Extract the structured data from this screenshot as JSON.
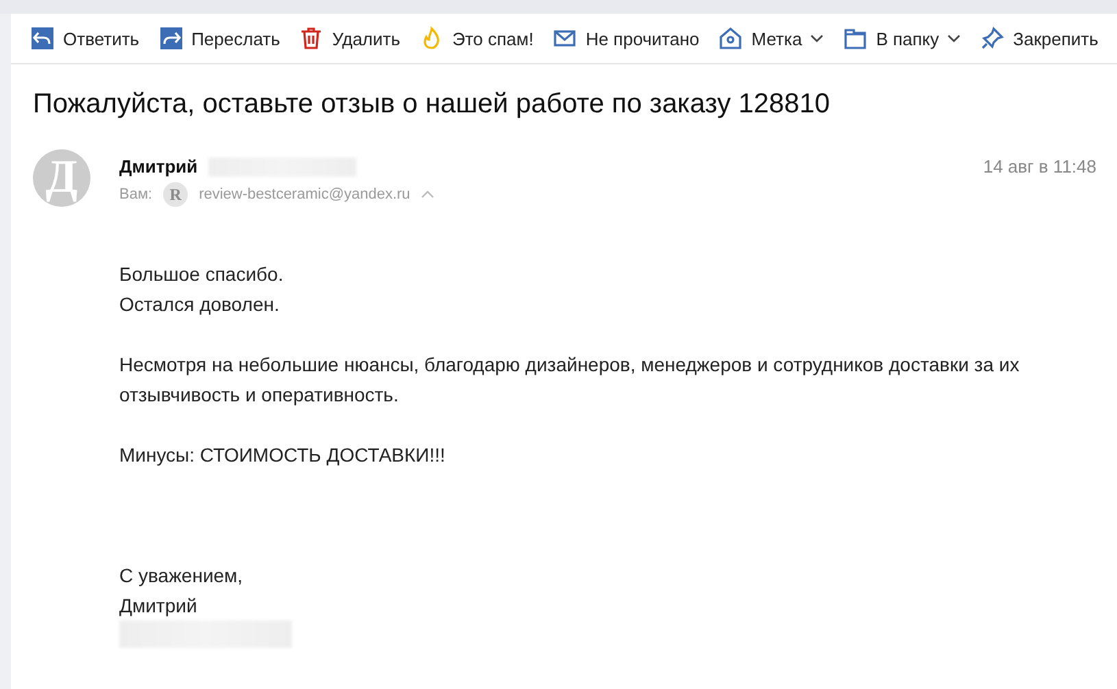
{
  "toolbar": [
    {
      "kind": "reply",
      "label": "Ответить",
      "has_menu": false
    },
    {
      "kind": "forward",
      "label": "Переслать",
      "has_menu": false
    },
    {
      "kind": "delete",
      "label": "Удалить",
      "has_menu": false
    },
    {
      "kind": "spam",
      "label": "Это спам!",
      "has_menu": false
    },
    {
      "kind": "unread",
      "label": "Не прочитано",
      "has_menu": false
    },
    {
      "kind": "label",
      "label": "Метка",
      "has_menu": true
    },
    {
      "kind": "folder",
      "label": "В папку",
      "has_menu": true
    },
    {
      "kind": "pin",
      "label": "Закрепить",
      "has_menu": false
    }
  ],
  "subject": "Пожалуйста, оставьте отзыв о нашей работе по заказу 128810",
  "message": {
    "avatar_letter": "Д",
    "sender": "Дмитрий",
    "to_label": "Вам:",
    "recipient_initial": "R",
    "recipient": "review-bestceramic@yandex.ru",
    "date": "14 авг в 11:48",
    "paragraphs": [
      [
        "Большое спасибо.",
        "Остался доволен."
      ],
      [
        "Несмотря на небольшие нюансы, благодарю дизайнеров, менеджеров и сотрудников доставки за их отзывчивость и оперативность."
      ],
      [
        "Минусы: СТОИМОСТЬ ДОСТАВКИ!!!"
      ]
    ],
    "signature": [
      "С уважением,",
      "Дмитрий"
    ]
  }
}
